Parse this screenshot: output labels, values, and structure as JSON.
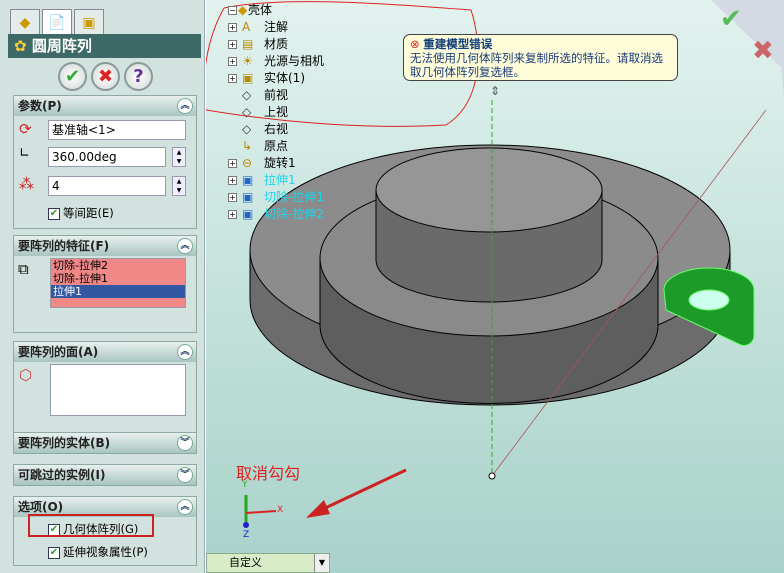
{
  "panel": {
    "tabs": [
      {
        "icon": "feature-manager-icon"
      },
      {
        "icon": "property-manager-icon"
      },
      {
        "icon": "configuration-manager-icon"
      }
    ],
    "title": "圆周阵列",
    "buttons": {
      "ok": "✔",
      "cancel": "✖",
      "help": "?"
    },
    "params": {
      "header": "参数(P)",
      "axis": "基准轴<1>",
      "angle": "360.00deg",
      "count": "4",
      "equal_spacing": "等间距(E)",
      "equal_spacing_checked": true
    },
    "features": {
      "header": "要阵列的特征(F)",
      "items": [
        "切除-拉伸2",
        "切除-拉伸1",
        "拉伸1"
      ],
      "selected": 2
    },
    "faces": {
      "header": "要阵列的面(A)"
    },
    "bodies": {
      "header": "要阵列的实体(B)"
    },
    "skip": {
      "header": "可跳过的实例(I)"
    },
    "options": {
      "header": "选项(O)",
      "geometry_pattern": "几何体阵列(G)",
      "geometry_pattern_checked": true,
      "propagate": "延伸视象属性(P)",
      "propagate_checked": true
    }
  },
  "tree": {
    "root": "壳体",
    "items": [
      {
        "label": "注解",
        "icon": "annotation-icon"
      },
      {
        "label": "材质",
        "icon": "material-icon"
      },
      {
        "label": "光源与相机",
        "icon": "lights-icon"
      },
      {
        "label": "实体(1)",
        "icon": "solid-body-icon"
      },
      {
        "label": "前视",
        "icon": "plane-icon"
      },
      {
        "label": "上视",
        "icon": "plane-icon"
      },
      {
        "label": "右视",
        "icon": "plane-icon"
      },
      {
        "label": "原点",
        "icon": "origin-icon"
      },
      {
        "label": "旋转1",
        "icon": "revolve-icon"
      },
      {
        "label": "拉伸1",
        "icon": "extrude-icon"
      },
      {
        "label": "切除-拉伸1",
        "icon": "cut-extrude-icon"
      },
      {
        "label": "切除-拉伸2",
        "icon": "cut-extrude-icon"
      }
    ]
  },
  "error": {
    "title": "重建模型错误",
    "message": "无法使用几何体阵列来复制所选的特征。请取消选取几何体阵列复选框。"
  },
  "annotation": "取消勾勾",
  "triad": {
    "x": "X",
    "y": "Y",
    "z": "Z"
  },
  "view_config": "自定义",
  "colors": {
    "accent": "#3d6a66",
    "error": "#cc2222",
    "highlight": "#f08888",
    "selection": "#3158a0"
  }
}
